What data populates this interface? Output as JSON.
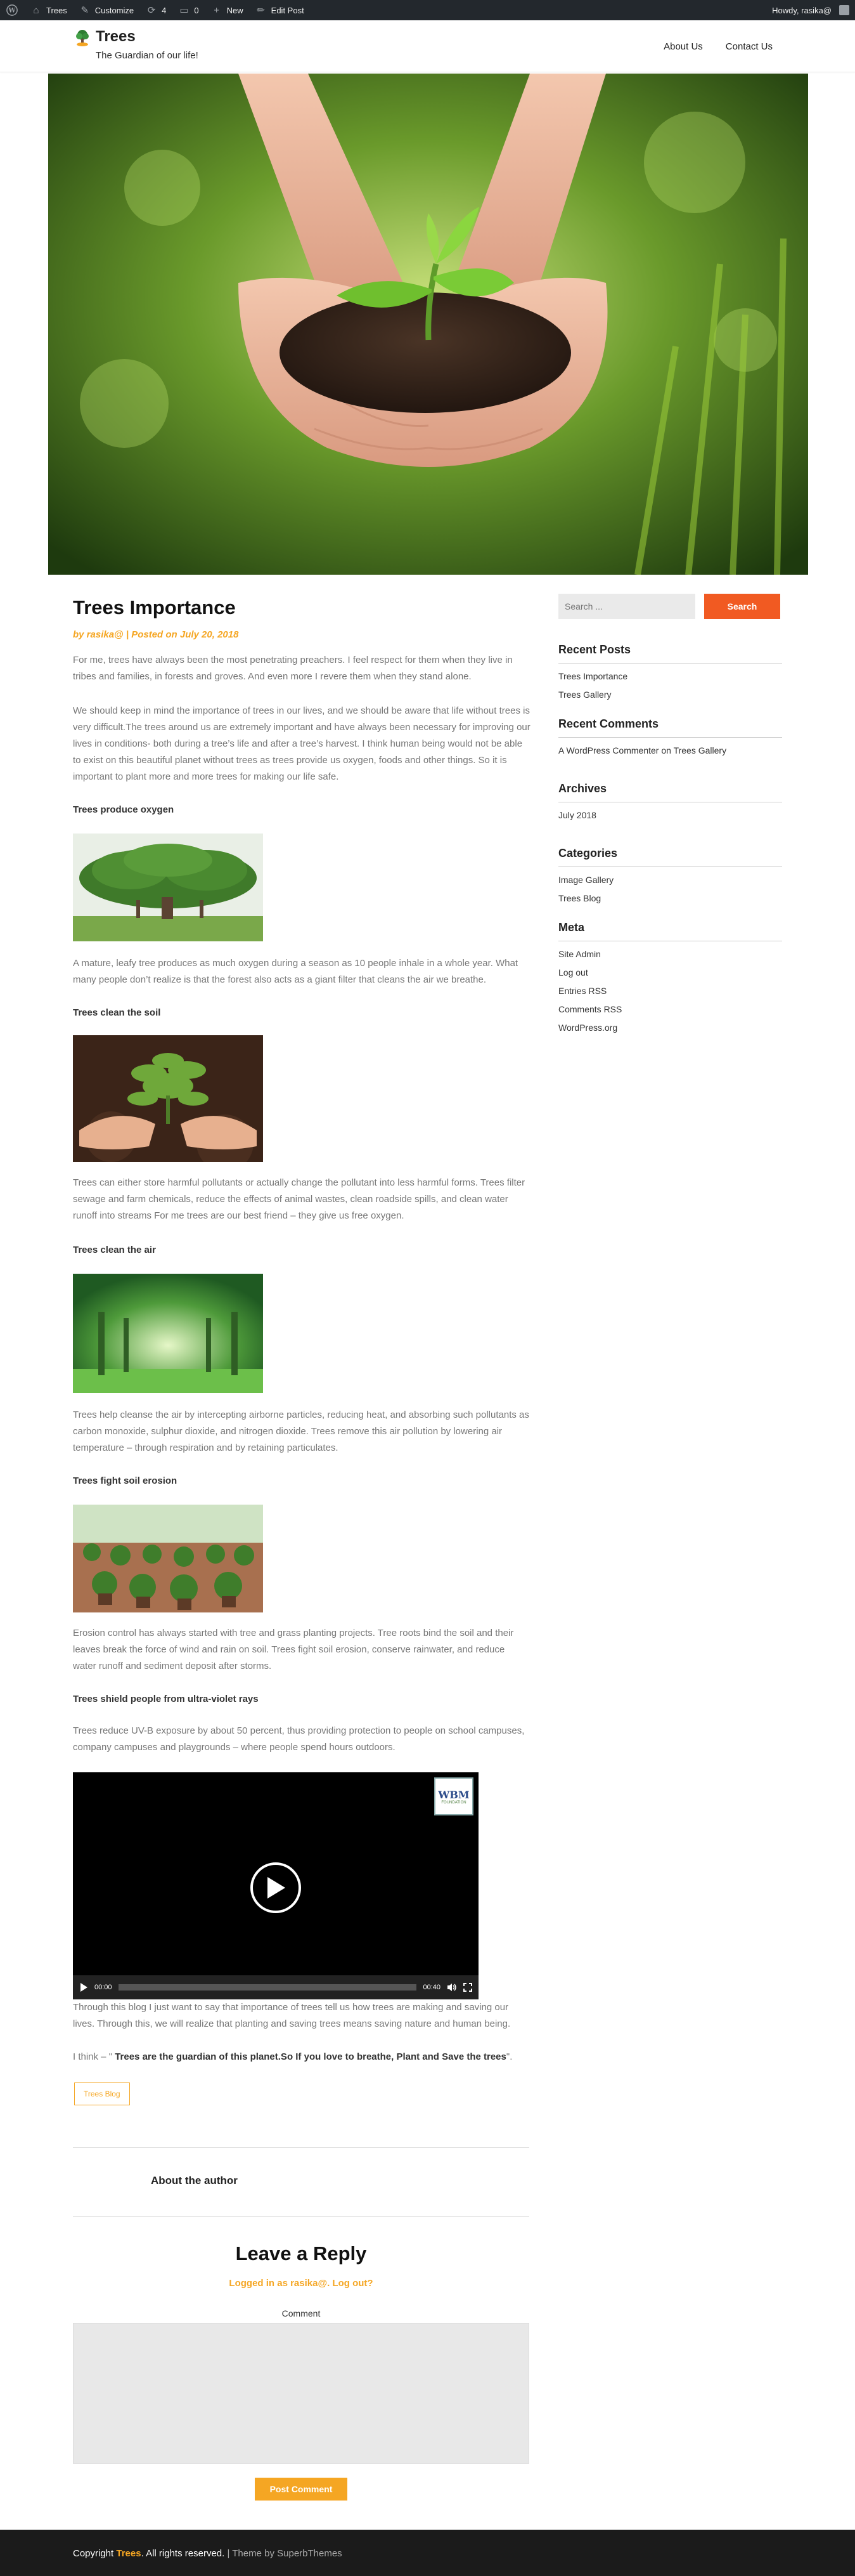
{
  "adminbar": {
    "site_name": "Trees",
    "customize": "Customize",
    "updates_count": "4",
    "comments_count": "0",
    "new": "New",
    "edit_post": "Edit Post",
    "howdy": "Howdy, rasika@"
  },
  "header": {
    "title": "Trees",
    "tagline": "The Guardian of our life!",
    "nav": [
      "About Us",
      "Contact Us"
    ]
  },
  "post": {
    "title": "Trees Importance",
    "meta": "by rasika@ | Posted on July 20, 2018",
    "intro": "For me, trees have always been the most penetrating preachers. I feel respect for them when they live in tribes and families, in forests and groves. And even more I revere them when they stand alone.",
    "para2": "We should keep in mind the importance of trees in our lives, and we should be aware that life without trees is very difficult.The trees around us are extremely important and have always been necessary for improving our lives in conditions- both during a tree’s life and after a tree’s harvest. I think human being would not be able to exist on this beautiful planet without trees as trees provide us oxygen, foods and other things. So it is important to plant more and more trees for making our life safe.",
    "h_oxygen": "Trees produce oxygen",
    "p_oxygen": "A mature, leafy tree produces as much oxygen during a season as 10 people inhale in a whole year. What many people don’t realize is that the forest also acts as a giant filter that cleans the air we breathe.",
    "h_soil": "Trees clean the soil",
    "p_soil": "Trees can either store harmful pollutants or actually change the pollutant into less harmful forms. Trees filter sewage and farm chemicals, reduce the effects of animal wastes, clean roadside spills, and clean water runoff into streams For me trees are our best friend – they give us free oxygen.",
    "h_air": "Trees clean the air",
    "p_air": "Trees help cleanse the air by intercepting airborne particles, reducing heat, and absorbing such pollutants as carbon monoxide, sulphur dioxide, and nitrogen dioxide. Trees remove this air pollution by lowering air temperature – through respiration and by retaining particulates.",
    "h_erosion": "Trees fight soil erosion",
    "p_erosion": "Erosion control has always started with tree and grass planting projects. Tree roots bind the soil and their leaves break the force of wind and rain on soil. Trees fight soil erosion, conserve rainwater, and reduce water runoff and sediment deposit after storms.",
    "h_uv": "Trees shield people from ultra-violet rays",
    "p_uv": "Trees reduce UV-B exposure by about 50 percent, thus providing protection to people on school campuses, company campuses and playgrounds – where people spend hours outdoors.",
    "video": {
      "watermark": "WBM",
      "watermark_sub": "FOUNDATION",
      "current_time": "00:00",
      "duration": "00:40",
      "progress": 0
    },
    "conclusion": "Through this blog I just want to say that importance of trees tell us how trees are making and saving our lives. Through this, we will realize that planting and saving trees means saving nature and human being.",
    "quote_prefix": "I think – \" ",
    "quote_bold": "Trees are the guardian of this planet.So If you love to breathe, Plant and Save the trees",
    "quote_suffix": "\".",
    "category_tag": "Trees Blog"
  },
  "author_box": {
    "heading": "About the author"
  },
  "reply": {
    "heading": "Leave a Reply",
    "logged_in_as": "Logged in as rasika@. Log out?",
    "comment_label": "Comment",
    "submit": "Post Comment"
  },
  "sidebar": {
    "search_placeholder": "Search ...",
    "search_button": "Search",
    "recent_posts_title": "Recent Posts",
    "recent_posts": [
      "Trees Importance",
      "Trees Gallery"
    ],
    "recent_comments_title": "Recent Comments",
    "recent_comment_author": "A WordPress Commenter",
    "recent_comment_on": " on ",
    "recent_comment_post": "Trees Gallery",
    "archives_title": "Archives",
    "archives": [
      "July 2018"
    ],
    "categories_title": "Categories",
    "categories": [
      "Image Gallery",
      "Trees Blog"
    ],
    "meta_title": "Meta",
    "meta": [
      "Site Admin",
      "Log out",
      "Entries RSS",
      "Comments RSS",
      "WordPress.org"
    ]
  },
  "footer": {
    "copyright_prefix": "Copyright ",
    "site": "Trees",
    "rights": ". All rights reserved.",
    "theme_prefix": " | Theme by ",
    "theme_author": "SuperbThemes"
  },
  "colors": {
    "accent": "#f5a623",
    "search_button": "#f15a22",
    "adminbar": "#23282d",
    "footer": "#1b1b1b"
  }
}
